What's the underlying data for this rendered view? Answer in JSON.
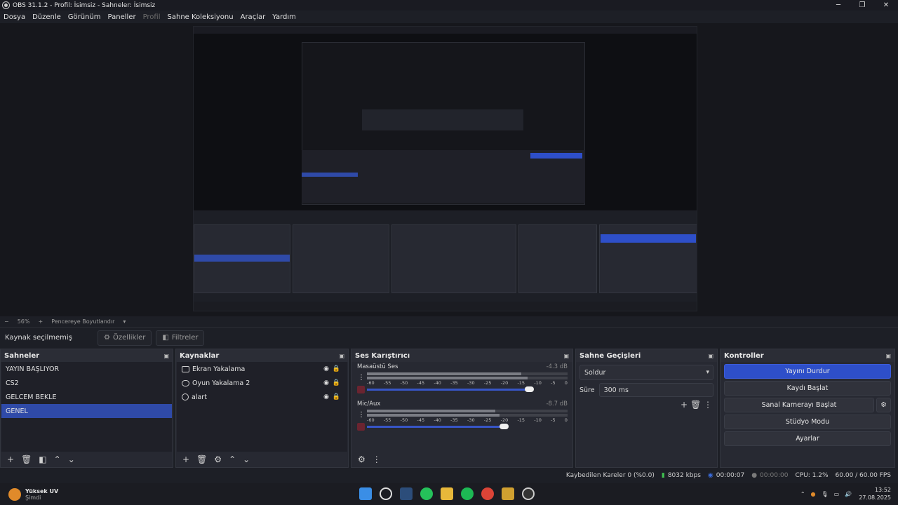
{
  "window": {
    "title": "OBS 31.1.2 - Profil: İsimsiz - Sahneler: İsimsiz"
  },
  "menu": [
    {
      "label": "Dosya",
      "enabled": true
    },
    {
      "label": "Düzenle",
      "enabled": true
    },
    {
      "label": "Görünüm",
      "enabled": true
    },
    {
      "label": "Paneller",
      "enabled": true
    },
    {
      "label": "Profil",
      "enabled": false
    },
    {
      "label": "Sahne Koleksiyonu",
      "enabled": true
    },
    {
      "label": "Araçlar",
      "enabled": true
    },
    {
      "label": "Yardım",
      "enabled": true
    }
  ],
  "zoom": {
    "minus": "−",
    "value": "56%",
    "plus": "+",
    "fit": "Pencereye Boyutlandır"
  },
  "properties": {
    "status": "Kaynak seçilmemiş",
    "props_btn": "Özellikler",
    "filters_btn": "Filtreler"
  },
  "scenes": {
    "title": "Sahneler",
    "items": [
      "YAYIN BAŞLIYOR",
      "CS2",
      "GELCEM BEKLE",
      "GENEL"
    ],
    "selected": 3
  },
  "sources": {
    "title": "Kaynaklar",
    "items": [
      "Ekran Yakalama",
      "Oyun Yakalama 2",
      "alart"
    ]
  },
  "mixer": {
    "title": "Ses Karıştırıcı",
    "channels": [
      {
        "name": "Masaüstü Ses",
        "db": "-4.3 dB",
        "level": 0.77
      },
      {
        "name": "Mic/Aux",
        "db": "-8.7 dB",
        "level": 0.62
      }
    ],
    "ticks": [
      "-60",
      "-55",
      "-50",
      "-45",
      "-40",
      "-35",
      "-30",
      "-25",
      "-20",
      "-15",
      "-10",
      "-5",
      "0"
    ]
  },
  "transitions": {
    "title": "Sahne Geçişleri",
    "type": "Soldur",
    "duration_label": "Süre",
    "duration": "300 ms"
  },
  "controls": {
    "title": "Kontroller",
    "buttons": [
      "Yayını Durdur",
      "Kaydı Başlat",
      "Sanal Kamerayı Başlat",
      "Stüdyo Modu",
      "Ayarlar"
    ]
  },
  "status": {
    "dropped": "Kaybedilen Kareler 0 (%0.0)",
    "bitrate": "8032 kbps",
    "stream_time": "00:00:07",
    "rec_time": "00:00:00",
    "cpu": "CPU: 1.2%",
    "fps": "60.00 / 60.00 FPS"
  },
  "taskbar": {
    "weather_title": "Yüksek UV",
    "weather_sub": "Şimdi",
    "time": "13:52",
    "date": "27.08.2025"
  },
  "colors": {
    "accent": "#2e4fc9",
    "bg": "#1d1f26",
    "dock": "#272932"
  }
}
